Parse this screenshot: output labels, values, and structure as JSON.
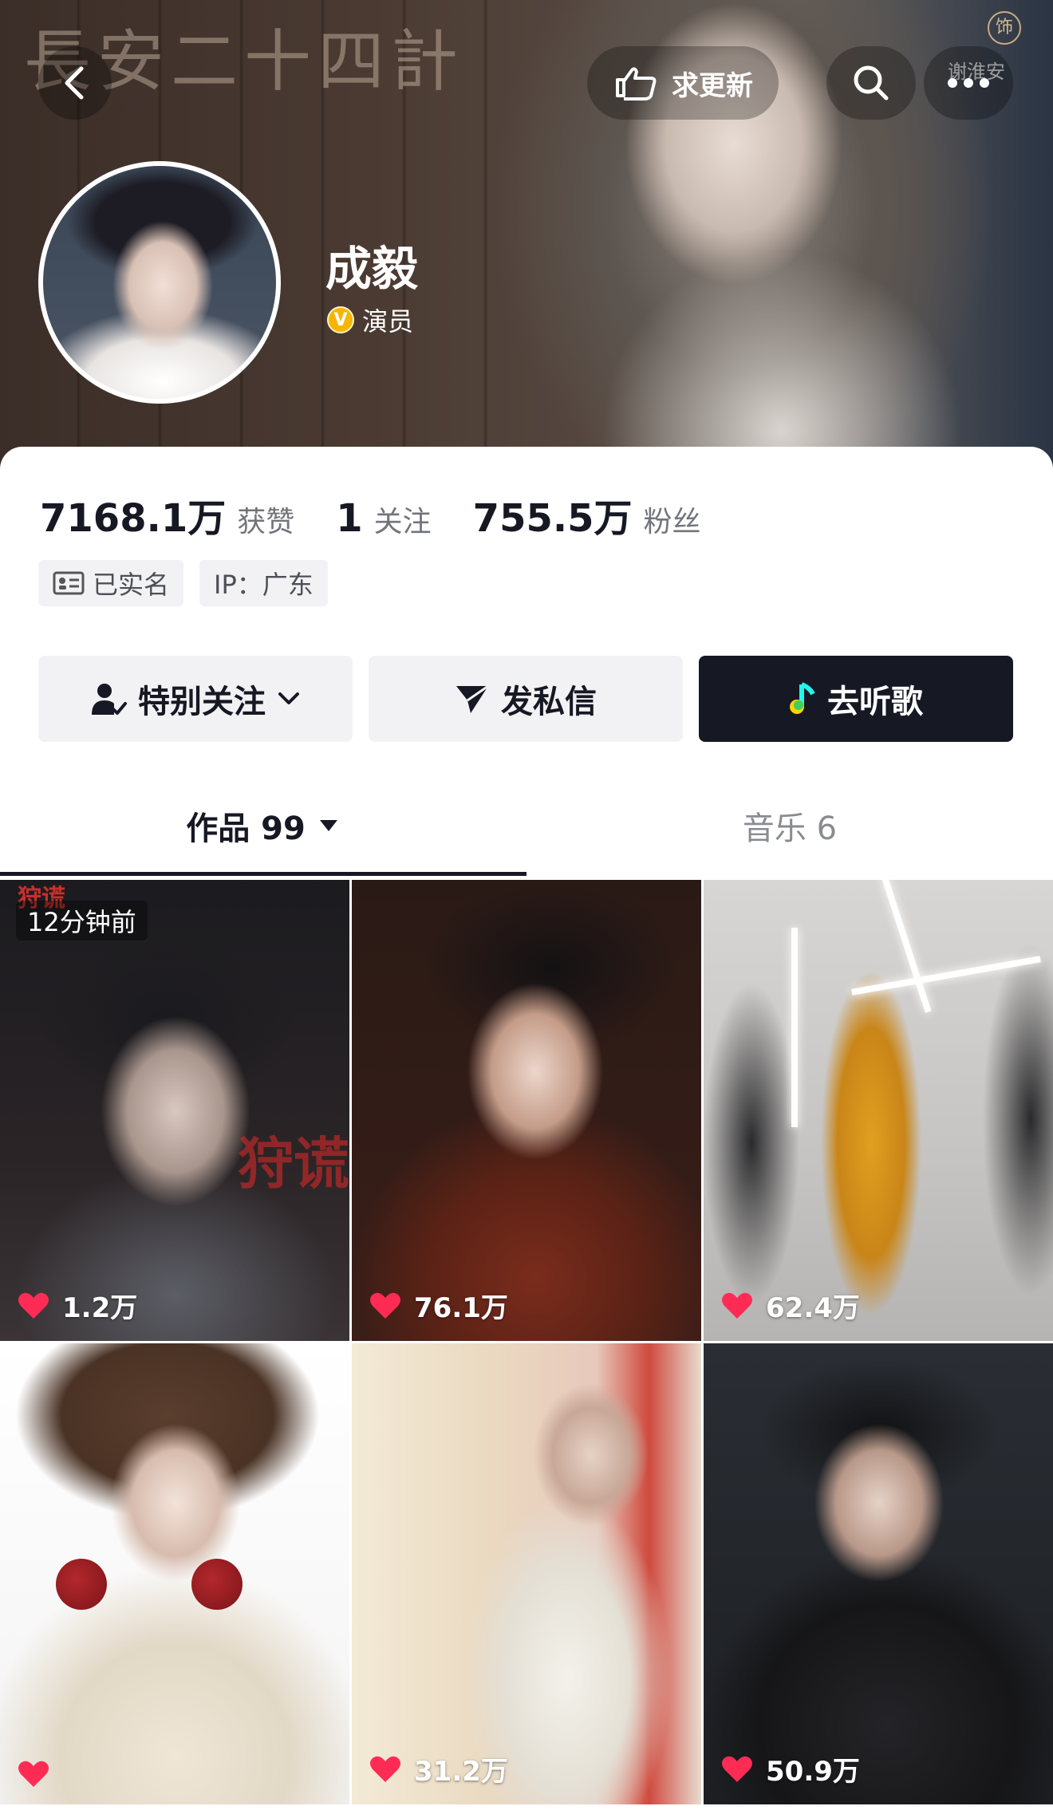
{
  "header": {
    "update_label": "求更新",
    "banner_calligraphy": "長安二十四計",
    "banner_corner_text": "谢淮安",
    "banner_seal": "饰"
  },
  "profile": {
    "name": "成毅",
    "verified_label": "演员"
  },
  "stats": [
    {
      "value": "7168.1万",
      "label": "获赞"
    },
    {
      "value": "1",
      "label": "关注"
    },
    {
      "value": "755.5万",
      "label": "粉丝"
    }
  ],
  "tags": [
    {
      "icon": "id-card-icon",
      "label": "已实名"
    },
    {
      "icon": "",
      "label": "IP：广东"
    }
  ],
  "actions": {
    "follow_label": "特别关注",
    "message_label": "发私信",
    "music_label": "去听歌"
  },
  "tabs": [
    {
      "label": "作品 99",
      "active": true
    },
    {
      "label": "音乐 6",
      "active": false
    }
  ],
  "videos": [
    {
      "likes": "1.2万",
      "time": "12分钟前",
      "overlay": "狩谎",
      "top_text": "狩谎"
    },
    {
      "likes": "76.1万"
    },
    {
      "likes": "62.4万"
    },
    {
      "likes": ""
    },
    {
      "likes": "31.2万"
    },
    {
      "likes": "50.9万"
    }
  ],
  "colors": {
    "primary_text": "#161823",
    "secondary_text": "#8a8b91",
    "button_bg": "#f2f2f4",
    "dark_button": "#161823",
    "heart": "#fe2c55",
    "verified_badge": "#f7b500"
  }
}
